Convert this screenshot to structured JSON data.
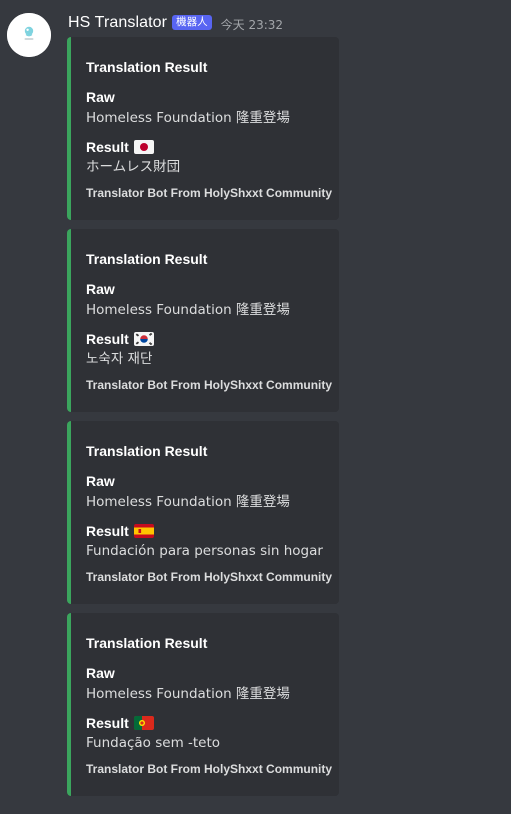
{
  "message": {
    "avatar_icon": "hs-logo-icon",
    "username": "HS Translator",
    "bot_tag": "機器人",
    "timestamp": "今天 23:32"
  },
  "embeds": [
    {
      "title": "Translation Result",
      "raw_label": "Raw",
      "raw_value": "Homeless Foundation 隆重登場",
      "result_label": "Result",
      "result_flag": "flag-japan-icon",
      "result_value": "ホームレス財団",
      "footer": "Translator Bot From HolyShxxt Community"
    },
    {
      "title": "Translation Result",
      "raw_label": "Raw",
      "raw_value": "Homeless Foundation 隆重登場",
      "result_label": "Result",
      "result_flag": "flag-south-korea-icon",
      "result_value": "노숙자 재단",
      "footer": "Translator Bot From HolyShxxt Community"
    },
    {
      "title": "Translation Result",
      "raw_label": "Raw",
      "raw_value": "Homeless Foundation 隆重登場",
      "result_label": "Result",
      "result_flag": "flag-spain-icon",
      "result_value": "Fundación para personas sin hogar",
      "footer": "Translator Bot From HolyShxxt Community"
    },
    {
      "title": "Translation Result",
      "raw_label": "Raw",
      "raw_value": "Homeless Foundation 隆重登場",
      "result_label": "Result",
      "result_flag": "flag-portugal-icon",
      "result_value": "Fundação sem -teto",
      "footer": "Translator Bot From HolyShxxt Community"
    }
  ],
  "colors": {
    "background": "#36393f",
    "embed_background": "#2f3136",
    "embed_accent": "#3ba55d",
    "bot_tag": "#5865f2"
  }
}
